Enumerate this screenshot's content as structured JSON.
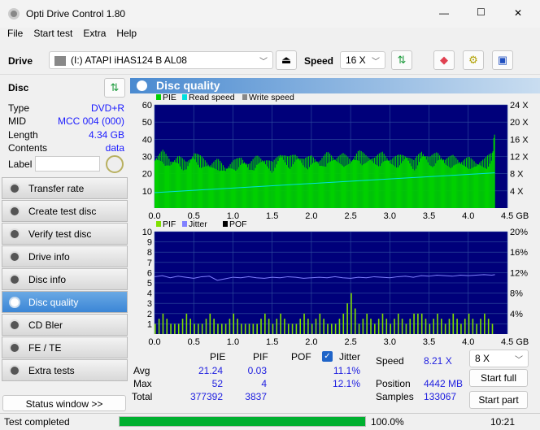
{
  "window": {
    "title": "Opti Drive Control 1.80",
    "minimize": "—",
    "maximize": "☐",
    "close": "✕"
  },
  "menu": [
    "File",
    "Start test",
    "Extra",
    "Help"
  ],
  "toolbar": {
    "drive_label": "Drive",
    "drive_value": "(I:)  ATAPI iHAS124   B AL08",
    "speed_label": "Speed",
    "speed_value": "16 X"
  },
  "disc": {
    "title": "Disc",
    "rows": [
      {
        "k": "Type",
        "v": "DVD+R"
      },
      {
        "k": "MID",
        "v": "MCC 004 (000)"
      },
      {
        "k": "Length",
        "v": "4.34 GB"
      },
      {
        "k": "Contents",
        "v": "data"
      }
    ],
    "label_key": "Label",
    "label_value": ""
  },
  "nav": [
    {
      "label": "Transfer rate"
    },
    {
      "label": "Create test disc"
    },
    {
      "label": "Verify test disc"
    },
    {
      "label": "Drive info"
    },
    {
      "label": "Disc info"
    },
    {
      "label": "Disc quality",
      "selected": true
    },
    {
      "label": "CD Bler"
    },
    {
      "label": "FE / TE"
    },
    {
      "label": "Extra tests"
    }
  ],
  "status_window_button": "Status window >>",
  "panel_title": "Disc quality",
  "colors": {
    "plot_bg": "#00007a",
    "pie": "#00d000",
    "pif": "#80e000",
    "read_speed": "#00e0e0",
    "jitter": "#8080ff",
    "progress": "#00b030"
  },
  "chart_data": [
    {
      "type": "bar",
      "legend": [
        "PIE",
        "Read speed",
        "Write speed"
      ],
      "xlim": [
        0,
        4.5
      ],
      "ylim": [
        0,
        60
      ],
      "y2lim": [
        0,
        24
      ],
      "xticks": [
        "0.0",
        "0.5",
        "1.0",
        "1.5",
        "2.0",
        "2.5",
        "3.0",
        "3.5",
        "4.0",
        "4.5 GB"
      ],
      "yticks": [
        "10",
        "20",
        "30",
        "40",
        "50",
        "60"
      ],
      "y2ticks": [
        "4 X",
        "8 X",
        "12 X",
        "16 X",
        "20 X",
        "24 X"
      ],
      "x": [
        0,
        0.1,
        0.2,
        0.3,
        0.4,
        0.5,
        0.6,
        0.7,
        0.8,
        0.9,
        1.0,
        1.1,
        1.2,
        1.3,
        1.4,
        1.5,
        1.6,
        1.7,
        1.8,
        1.9,
        2.0,
        2.1,
        2.2,
        2.3,
        2.4,
        2.5,
        2.6,
        2.7,
        2.8,
        2.9,
        3.0,
        3.1,
        3.2,
        3.3,
        3.4,
        3.5,
        3.6,
        3.7,
        3.8,
        3.9,
        4.0,
        4.1,
        4.2,
        4.3,
        4.34
      ],
      "pie": [
        30,
        34,
        28,
        31,
        27,
        33,
        30,
        26,
        29,
        24,
        28,
        30,
        26,
        31,
        29,
        27,
        33,
        30,
        32,
        29,
        31,
        28,
        33,
        30,
        32,
        29,
        34,
        31,
        30,
        33,
        29,
        31,
        32,
        28,
        34,
        30,
        33,
        29,
        31,
        28,
        30,
        27,
        29,
        33,
        52
      ],
      "read_speed": {
        "start": 3.6,
        "end": 8.2
      }
    },
    {
      "type": "bar",
      "legend": [
        "PIF",
        "Jitter",
        "POF"
      ],
      "xlim": [
        0,
        4.5
      ],
      "ylim": [
        0,
        10
      ],
      "y2lim": [
        0,
        20
      ],
      "xticks": [
        "0.0",
        "0.5",
        "1.0",
        "1.5",
        "2.0",
        "2.5",
        "3.0",
        "3.5",
        "4.0",
        "4.5 GB"
      ],
      "yticks": [
        "1",
        "2",
        "3",
        "4",
        "5",
        "6",
        "7",
        "8",
        "9",
        "10"
      ],
      "y2ticks": [
        "4%",
        "8%",
        "12%",
        "16%",
        "20%"
      ],
      "x": [
        0,
        0.1,
        0.2,
        0.3,
        0.4,
        0.5,
        0.6,
        0.7,
        0.8,
        0.9,
        1.0,
        1.1,
        1.2,
        1.3,
        1.4,
        1.5,
        1.6,
        1.7,
        1.8,
        1.9,
        2.0,
        2.1,
        2.2,
        2.3,
        2.4,
        2.5,
        2.6,
        2.7,
        2.8,
        2.9,
        3.0,
        3.1,
        3.2,
        3.3,
        3.4,
        3.5,
        3.6,
        3.7,
        3.8,
        3.9,
        4.0,
        4.1,
        4.2,
        4.3,
        4.34
      ],
      "pif": [
        1,
        2,
        1,
        1,
        2,
        1,
        1,
        2,
        1,
        1,
        2,
        1,
        1,
        1,
        2,
        1,
        2,
        1,
        1,
        2,
        1,
        2,
        1,
        1,
        2,
        4,
        1,
        2,
        1,
        2,
        1,
        2,
        1,
        2,
        2,
        1,
        2,
        1,
        2,
        1,
        2,
        1,
        2,
        1,
        2
      ],
      "jitter": [
        11.2,
        11.4,
        11.0,
        11.3,
        11.1,
        10.9,
        11.2,
        11.3,
        10.5,
        10.8,
        11.1,
        11.0,
        11.2,
        11.0,
        10.9,
        11.1,
        11.0,
        11.2,
        11.1,
        10.9,
        11.0,
        11.1,
        11.0,
        11.2,
        11.0,
        10.9,
        11.1,
        11.0,
        11.2,
        11.1,
        11.0,
        11.2,
        11.3,
        11.1,
        11.4,
        11.3,
        11.5,
        11.4,
        11.3,
        11.5,
        11.4,
        11.5,
        11.6,
        11.5,
        11.6
      ]
    }
  ],
  "stats": {
    "headers": [
      "PIE",
      "PIF",
      "POF",
      "Jitter"
    ],
    "jitter_checked": true,
    "rows": [
      {
        "label": "Avg",
        "pie": "21.24",
        "pif": "0.03",
        "pof": "",
        "jitter": "11.1%"
      },
      {
        "label": "Max",
        "pie": "52",
        "pif": "4",
        "pof": "",
        "jitter": "12.1%"
      },
      {
        "label": "Total",
        "pie": "377392",
        "pif": "3837",
        "pof": "",
        "jitter": ""
      }
    ],
    "speed_label": "Speed",
    "speed_value": "8.21 X",
    "position_label": "Position",
    "position_value": "4442 MB",
    "samples_label": "Samples",
    "samples_value": "133067",
    "speed_select": "8 X",
    "start_full": "Start full",
    "start_part": "Start part"
  },
  "status": {
    "text": "Test completed",
    "progress": 100.0,
    "progress_text": "100.0%",
    "time": "10:21"
  }
}
